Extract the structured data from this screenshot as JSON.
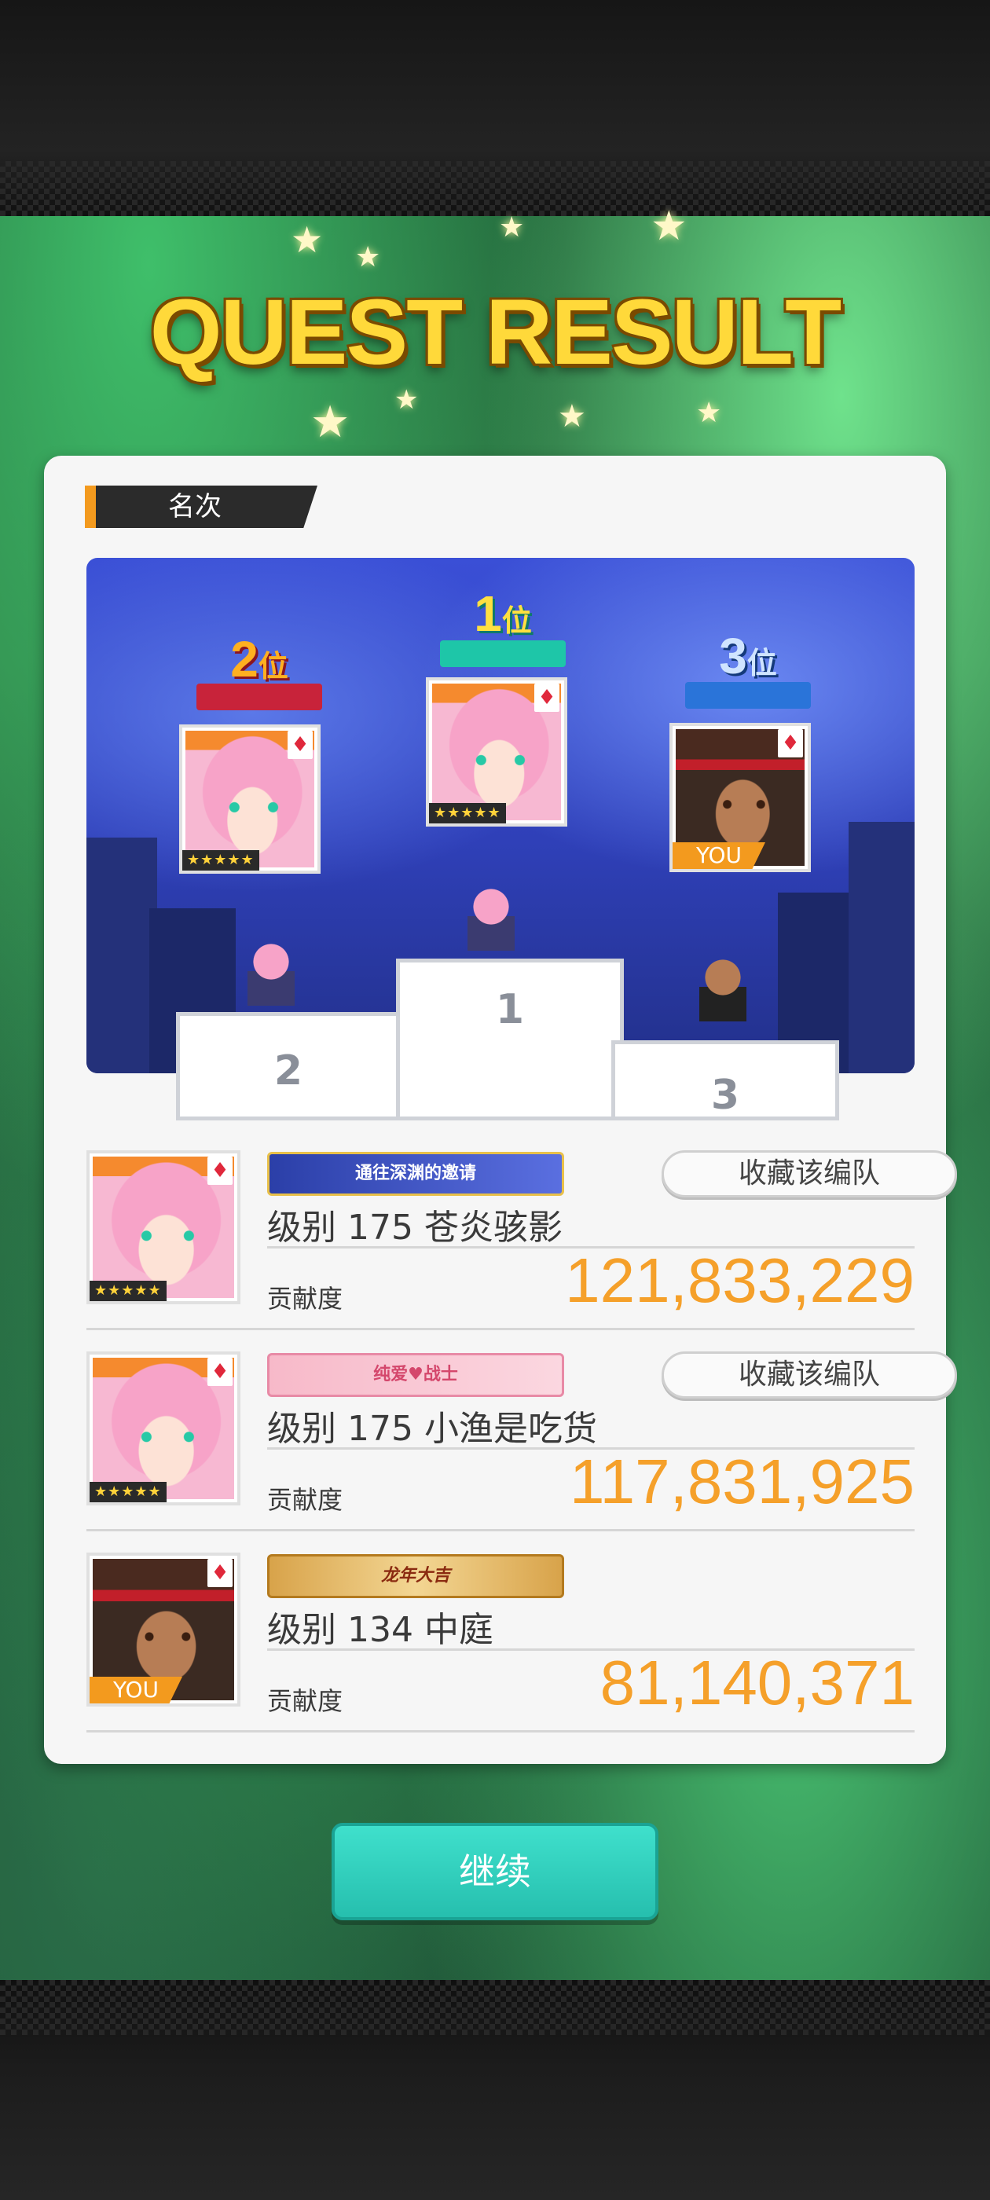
{
  "header": {
    "title": "QUEST RESULT"
  },
  "section": {
    "label": "名次"
  },
  "podium": {
    "first": {
      "num": "1",
      "suffix": "位",
      "block": "1"
    },
    "second": {
      "num": "2",
      "suffix": "位",
      "block": "2"
    },
    "third": {
      "num": "3",
      "suffix": "位",
      "block": "3",
      "you_label": "YOU"
    }
  },
  "results": [
    {
      "rank": 1,
      "title_badge": "通往深渊的邀请",
      "favorite_label": "收藏该编队",
      "player": "级别 175 苍炎骇影",
      "contribution_label": "贡献度",
      "contribution_value": "121,833,229",
      "stars": "★★★★★"
    },
    {
      "rank": 2,
      "title_badge": "纯爱♥战士",
      "favorite_label": "收藏该编队",
      "player": "级别 175 小渔是吃货",
      "contribution_label": "贡献度",
      "contribution_value": "117,831,925",
      "stars": "★★★★★"
    },
    {
      "rank": 3,
      "title_badge": "龙年大吉",
      "player": "级别 134 中庭",
      "contribution_label": "贡献度",
      "contribution_value": "81,140,371",
      "you_label": "YOU"
    }
  ],
  "card": {
    "suit": "♦",
    "stars": "★★★★★"
  },
  "footer": {
    "continue_label": "继续"
  },
  "colors": {
    "accent": "#f39a1e",
    "contribution": "#f5a02a",
    "continue": "#2fcfbc"
  }
}
